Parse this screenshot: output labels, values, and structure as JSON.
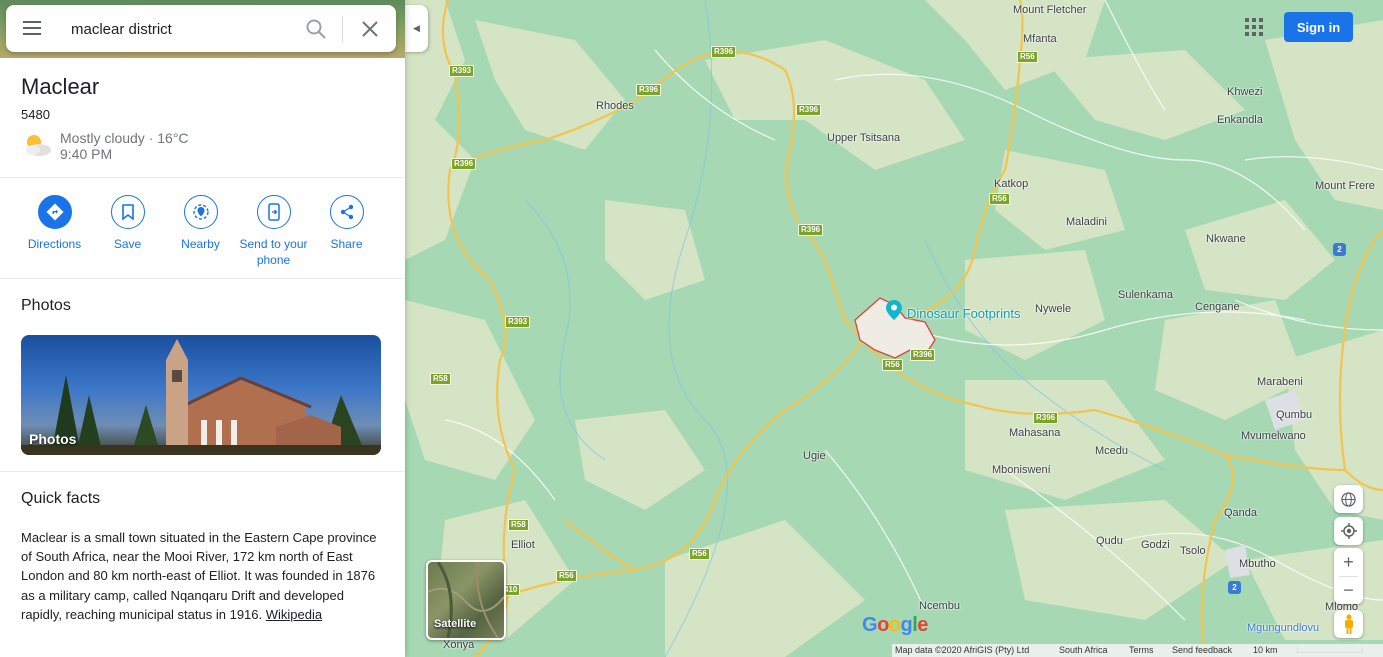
{
  "search": {
    "query": "maclear district",
    "menu_icon": "hamburger-menu-icon",
    "search_icon": "search-icon",
    "close_icon": "close-icon"
  },
  "place": {
    "title": "Maclear",
    "subtitle": "5480",
    "weather": {
      "icon": "partly-cloudy-icon",
      "description": "Mostly cloudy · 16°C",
      "time": "9:40 PM"
    }
  },
  "actions": [
    {
      "label": "Directions",
      "icon": "directions-icon"
    },
    {
      "label": "Save",
      "icon": "bookmark-icon"
    },
    {
      "label": "Nearby",
      "icon": "nearby-icon"
    },
    {
      "label": "Send to your phone",
      "icon": "send-to-phone-icon"
    },
    {
      "label": "Share",
      "icon": "share-icon"
    }
  ],
  "photos": {
    "heading": "Photos",
    "card_label": "Photos"
  },
  "quick_facts": {
    "heading": "Quick facts",
    "text": "Maclear is a small town situated in the Eastern Cape province of South Africa, near the Mooi River, 172 km north of East London and 80 km north-east of Elliot. It was founded in 1876 as a military camp, called Nqanqaru Drift and developed rapidly, reaching municipal status in 1916.",
    "link": "Wikipedia"
  },
  "map": {
    "place_labels": [
      "Mount Fletcher",
      "Mfanta",
      "Khwezi",
      "Enkandla",
      "Rhodes",
      "Upper Tsitsana",
      "Katkop",
      "Maladini",
      "Mount Frere",
      "Nkwane",
      "Sulenkama",
      "Nywele",
      "Cengane",
      "Marabeni",
      "Qumbu",
      "Mvumelwano",
      "Mahasana",
      "Mcedu",
      "Ugie",
      "Mboniswení",
      "Elliot",
      "Qudu",
      "Godzi",
      "Tsolo",
      "Qanda",
      "Mbutho",
      "Mlomo",
      "Ncembu",
      "Xonya",
      "Mgungundlovu"
    ],
    "poi": "Dinosaur Footprints",
    "road_shields": [
      "R393",
      "R396",
      "R56",
      "R58",
      "410",
      "2"
    ],
    "satellite_label": "Satellite",
    "signin": "Sign in",
    "apps_icon": "apps-grid-icon",
    "controls": {
      "globe": "globe-icon",
      "location": "my-location-icon",
      "zoom_in": "+",
      "zoom_out": "−",
      "pegman": "pegman-icon",
      "collapse": "collapse-arrow-icon"
    },
    "google_logo": "Google",
    "footer": {
      "attribution": "Map data ©2020 AfriGIS (Pty) Ltd",
      "country": "South Africa",
      "terms": "Terms",
      "feedback": "Send feedback",
      "scale": "10 km"
    }
  },
  "colors": {
    "accent": "#1a73e8",
    "map_base": "#a6d8b3",
    "road": "#f6c344",
    "shield": "#7ba428",
    "boundary": "#db4437"
  }
}
